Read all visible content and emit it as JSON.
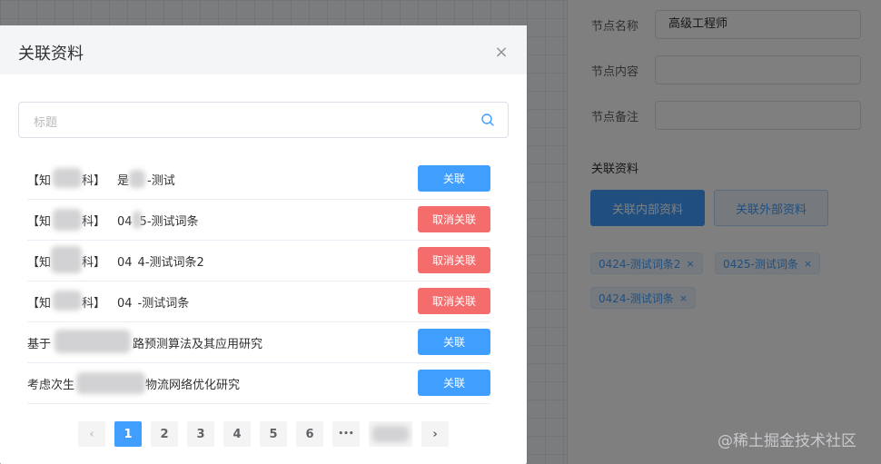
{
  "side_panel": {
    "node_name_label": "节点名称",
    "node_name_value": "高级工程师",
    "node_content_label": "节点内容",
    "node_content_value": "",
    "node_remark_label": "节点备注",
    "node_remark_value": "",
    "section_title": "关联资料",
    "btn_internal": "关联内部资料",
    "btn_external": "关联外部资料",
    "tags": [
      {
        "label": "0424-测试词条2",
        "close": "×"
      },
      {
        "label": "0425-测试词条",
        "close": "×"
      },
      {
        "label": "0424-测试词条",
        "close": "×"
      }
    ]
  },
  "dialog": {
    "title": "关联资料",
    "close": "×",
    "search_placeholder": "标题",
    "rows": [
      {
        "cat_left": "【知",
        "cat_right": "科】",
        "title_a": "是",
        "title_b": "-测试",
        "action": "关联",
        "action_type": "link"
      },
      {
        "cat_left": "【知",
        "cat_right": "科】",
        "title_a": "04",
        "title_b": "5-测试词条",
        "action": "取消关联",
        "action_type": "unlink"
      },
      {
        "cat_left": "【知",
        "cat_right": "科】",
        "title_a": "04",
        "title_b": "4-测试词条2",
        "action": "取消关联",
        "action_type": "unlink"
      },
      {
        "cat_left": "【知",
        "cat_right": "科】",
        "title_a": "04",
        "title_b": "-测试词条",
        "action": "取消关联",
        "action_type": "unlink"
      },
      {
        "text_a": "基于",
        "text_b": "路预测算法及其应用研究",
        "action": "关联",
        "action_type": "link"
      },
      {
        "text_a": "考虑次生",
        "text_b": "物流网络优化研究",
        "action": "关联",
        "action_type": "link"
      }
    ],
    "pagination": {
      "prev": "‹",
      "pages": [
        "1",
        "2",
        "3",
        "4",
        "5",
        "6"
      ],
      "active": "1",
      "ellipsis": "•••",
      "next": "›"
    }
  },
  "watermark": "@稀土掘金技术社区",
  "colors": {
    "primary": "#409eff",
    "danger": "#f56c6c"
  }
}
